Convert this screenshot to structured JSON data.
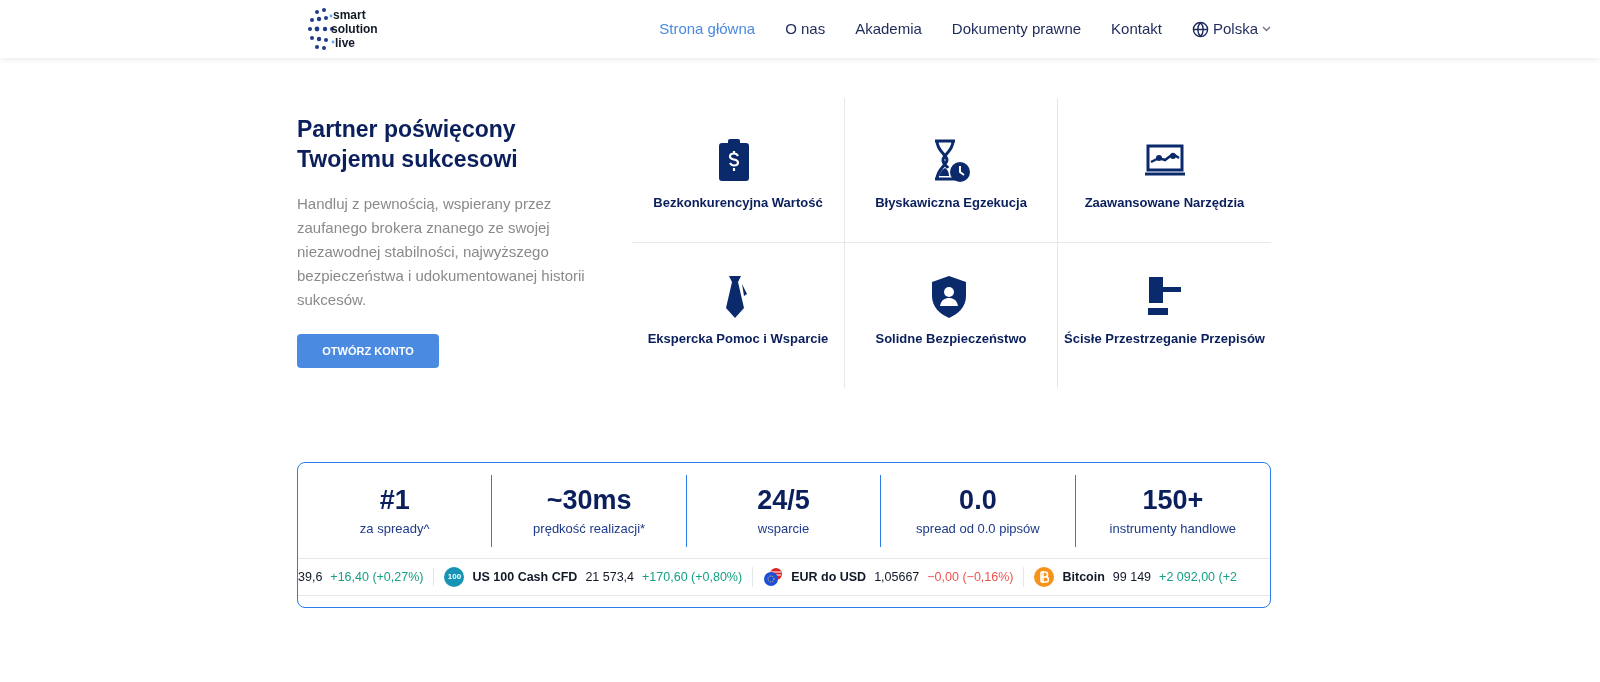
{
  "logo": {
    "lines": [
      "smart",
      "solution",
      "live"
    ]
  },
  "nav": [
    {
      "label": "Strona główna",
      "selected": true
    },
    {
      "label": "O nas",
      "selected": false
    },
    {
      "label": "Akademia",
      "selected": false
    },
    {
      "label": "Dokumenty prawne",
      "selected": false
    },
    {
      "label": "Kontakt",
      "selected": false
    }
  ],
  "language": {
    "label": "Polska"
  },
  "hero": {
    "title": "Partner poświęcony Twojemu sukcesowi",
    "text": "Handluj z pewnością, wspierany przez zaufanego brokera znanego ze swojej niezawodnej stabilności, najwyższego bezpieczeństwa i udokumentowanej historii sukcesów.",
    "button": "OTWÓRZ KONTO"
  },
  "features": [
    {
      "kind": "clipboard",
      "label": "Bezkonkurencyjna Wartość"
    },
    {
      "kind": "hourglass",
      "label": "Błyskawiczna Egzekucja"
    },
    {
      "kind": "chart",
      "label": "Zaawansowane Narzędzia"
    },
    {
      "kind": "tie",
      "label": "Ekspercka Pomoc i Wsparcie"
    },
    {
      "kind": "shield",
      "label": "Solidne Bezpieczeństwo"
    },
    {
      "kind": "gavel",
      "label": "Ścisłe Przestrzeganie Przepisów"
    }
  ],
  "stats": [
    {
      "value": "#1",
      "label": "za spready^"
    },
    {
      "value": "~30ms",
      "label": "prędkość realizacji*"
    },
    {
      "value": "24/5",
      "label": "wsparcie"
    },
    {
      "value": "0.0",
      "label": "spread od 0.0 pipsów"
    },
    {
      "value": "150+",
      "label": "instrumenty handlowe"
    }
  ],
  "ticker": [
    {
      "kind": "none",
      "price": "39,6",
      "change": "+16,40 (+0,27%)",
      "color": "#16a085"
    },
    {
      "kind": "index",
      "badge": "100",
      "name": "US 100 Cash CFD",
      "price": "21 573,4",
      "change": "+170,60 (+0,80%)",
      "color": "#16a085"
    },
    {
      "kind": "flags",
      "name": "EUR do USD",
      "price": "1,05667",
      "change": "−0,00 (−0,16%)",
      "color": "#ef5350"
    },
    {
      "kind": "bitcoin",
      "name": "Bitcoin",
      "price": "99 149",
      "change": "+2 092,00 (+2",
      "color": "#16a085"
    }
  ]
}
